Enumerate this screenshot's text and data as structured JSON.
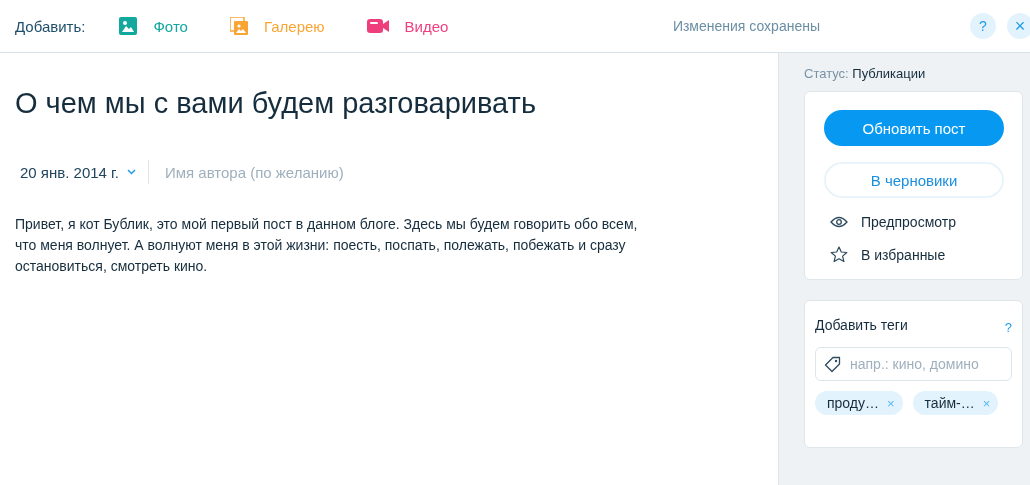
{
  "toolbar": {
    "label": "Добавить:",
    "items": [
      {
        "kind": "photo",
        "label": "Фото",
        "color": "#13a89e"
      },
      {
        "kind": "gallery",
        "label": "Галерею",
        "color": "#f9a534"
      },
      {
        "kind": "video",
        "label": "Видео",
        "color": "#ee3f7c"
      }
    ],
    "save_status": "Изменения сохранены",
    "help": "?",
    "close": "×"
  },
  "post": {
    "title": "О чем мы с вами будем разговаривать",
    "date": "20 янв. 2014 г.",
    "author_placeholder": "Имя автора (по желанию)",
    "body": "Привет, я кот Бублик, это мой первый пост в данном блоге. Здесь мы будем говорить обо всем, что меня волнует. А волнуют меня в этой жизни: поесть, поспать, полежать, побежать и сразу остановиться, смотреть кино."
  },
  "sidebar": {
    "status_label": "Статус:",
    "status_value": "Публикации",
    "primary_button": "Обновить пост",
    "secondary_button": "В черновики",
    "actions": [
      {
        "kind": "preview",
        "label": "Предпросмотр"
      },
      {
        "kind": "favorite",
        "label": "В избранные"
      }
    ],
    "tags": {
      "title": "Добавить теги",
      "help": "?",
      "placeholder": "напр.: кино, домино",
      "items": [
        {
          "label": "проду…",
          "remove": "×"
        },
        {
          "label": "тайм-…",
          "remove": "×"
        }
      ]
    }
  }
}
